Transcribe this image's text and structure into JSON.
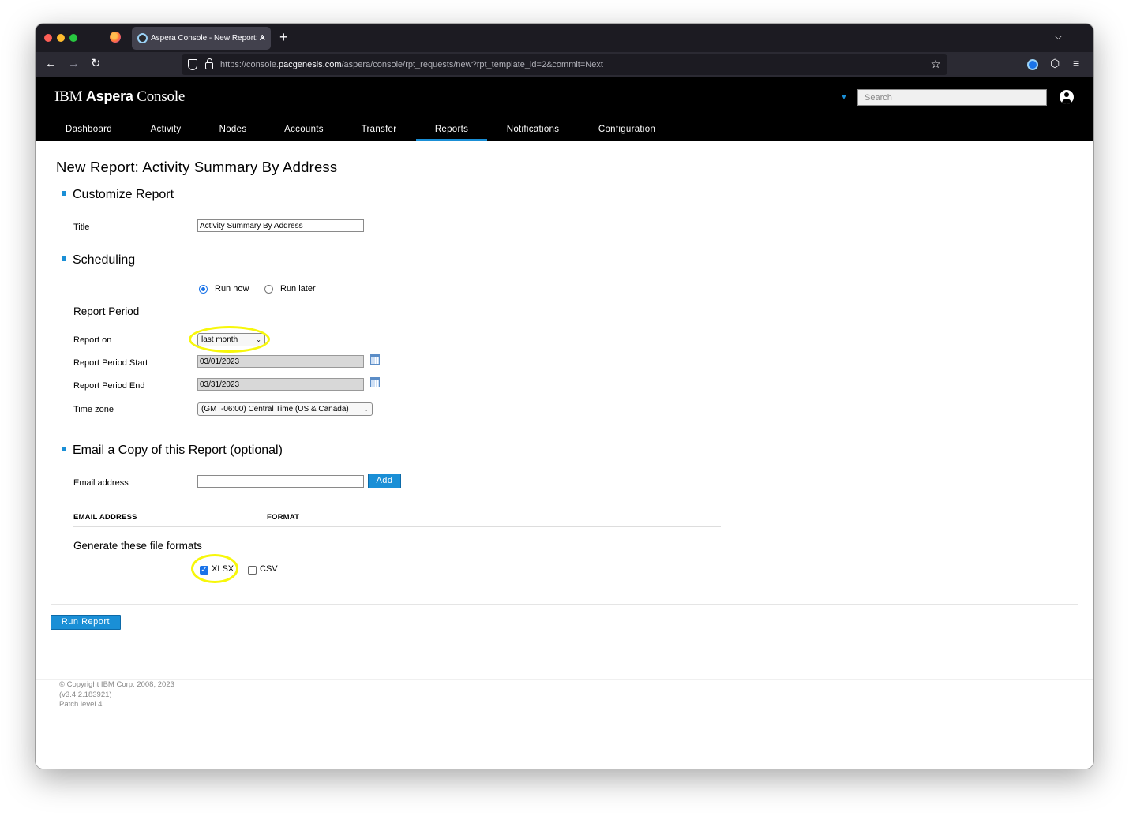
{
  "browser": {
    "tab_title": "Aspera Console - New Report: A",
    "tab_close": "×",
    "new_tab": "+",
    "tab_list": "⌵",
    "url_prefix": "https://console.",
    "url_domain": "pacgenesis.com",
    "url_path": "/aspera/console/rpt_requests/new?rpt_template_id=2&commit=Next",
    "back": "←",
    "forward": "→",
    "reload": "↻",
    "bookmark": "☆",
    "extensions": "⬡",
    "menu": "≡"
  },
  "app": {
    "brand_ibm": "IBM",
    "brand_aspera": "Aspera",
    "brand_console": "Console",
    "search_caret": "▼",
    "search_placeholder": "Search",
    "nav": [
      {
        "label": "Dashboard"
      },
      {
        "label": "Activity"
      },
      {
        "label": "Nodes"
      },
      {
        "label": "Accounts"
      },
      {
        "label": "Transfer"
      },
      {
        "label": "Reports"
      },
      {
        "label": "Notifications"
      },
      {
        "label": "Configuration"
      }
    ],
    "active_nav": "Reports"
  },
  "page": {
    "title": "New Report: Activity Summary By Address",
    "customize": {
      "heading": "Customize Report",
      "title_label": "Title",
      "title_value": "Activity Summary By Address"
    },
    "scheduling": {
      "heading": "Scheduling",
      "run_now": "Run now",
      "run_later": "Run later",
      "selected": "Run now",
      "period_heading": "Report Period",
      "report_on_label": "Report on",
      "report_on_value": "last month",
      "start_label": "Report Period Start",
      "start_value": "03/01/2023",
      "end_label": "Report Period End",
      "end_value": "03/31/2023",
      "timezone_label": "Time zone",
      "timezone_value": "(GMT-06:00) Central Time (US & Canada)"
    },
    "email": {
      "heading": "Email a Copy of this Report (optional)",
      "address_label": "Email address",
      "address_value": "",
      "add_button": "Add",
      "col_email": "EMAIL ADDRESS",
      "col_format": "FORMAT"
    },
    "formats": {
      "heading": "Generate these file formats",
      "xlsx_label": "XLSX",
      "xlsx_checked": true,
      "csv_label": "CSV",
      "csv_checked": false
    },
    "run_button": "Run Report"
  },
  "footer": {
    "copyright": "© Copyright IBM Corp. 2008, 2023",
    "version": "(v3.4.2.183921)",
    "patch": "Patch level 4"
  },
  "colors": {
    "accent": "#1a8fd6",
    "header_bg": "#000000",
    "highlight": "#f7f70a"
  }
}
